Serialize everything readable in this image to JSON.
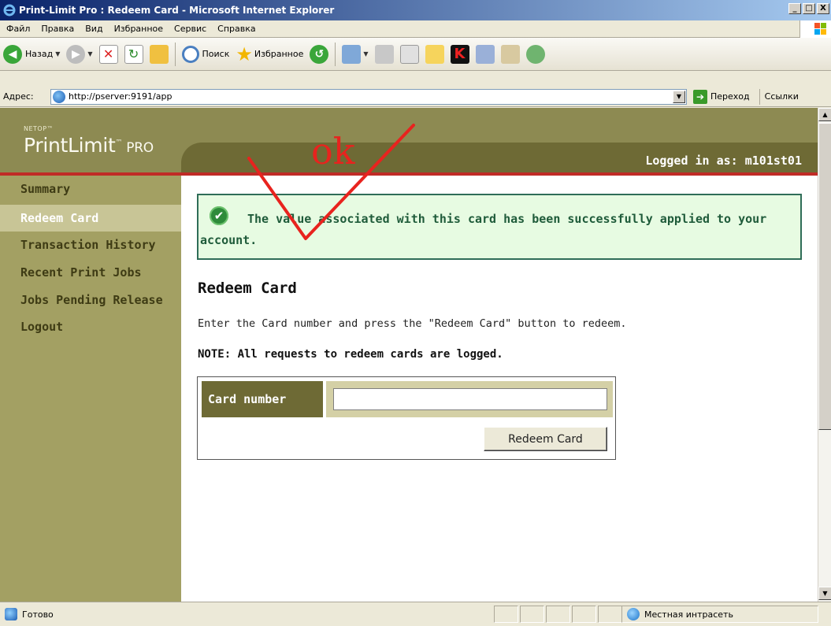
{
  "window": {
    "title": "Print-Limit Pro : Redeem Card - Microsoft Internet Explorer",
    "minimize": "_",
    "maximize": "□",
    "close": "X"
  },
  "menu": [
    "Файл",
    "Правка",
    "Вид",
    "Избранное",
    "Сервис",
    "Справка"
  ],
  "toolbar": {
    "back_label": "Назад",
    "search_label": "Поиск",
    "favorites_label": "Избранное"
  },
  "address": {
    "label": "Адрес:",
    "url": "http://pserver:9191/app",
    "go_label": "Переход",
    "links_label": "Ссылки"
  },
  "page": {
    "logo_small": "NETOP™",
    "logo_main": "PrintLimit",
    "logo_tm": "™",
    "logo_pro": " PRO",
    "logged_in": "Logged in as: m101st01",
    "nav": [
      {
        "label": "Summary",
        "active": false
      },
      {
        "label": "Redeem Card",
        "active": true
      },
      {
        "label": "Transaction History",
        "active": false
      },
      {
        "label": "Recent Print Jobs",
        "active": false
      },
      {
        "label": "Jobs Pending Release",
        "active": false
      },
      {
        "label": "Logout",
        "active": false
      }
    ],
    "success_message": "The value associated with this card has been successfully applied to your account.",
    "heading": "Redeem Card",
    "instructions": "Enter the Card number and press the \"Redeem Card\" button to redeem.",
    "note": "NOTE: All requests to redeem cards are logged.",
    "card_label": "Card number",
    "card_value": "",
    "redeem_button": "Redeem Card",
    "annotation": "ok"
  },
  "status": {
    "text": "Готово",
    "zone": "Местная интрасеть"
  },
  "colors": {
    "header": "#8D8A52",
    "band": "#6E6A35",
    "accent_red": "#C02B26",
    "sidebar": "#A3A063",
    "success_bg": "#E7FBE2",
    "annotation_red": "#E8231E"
  }
}
